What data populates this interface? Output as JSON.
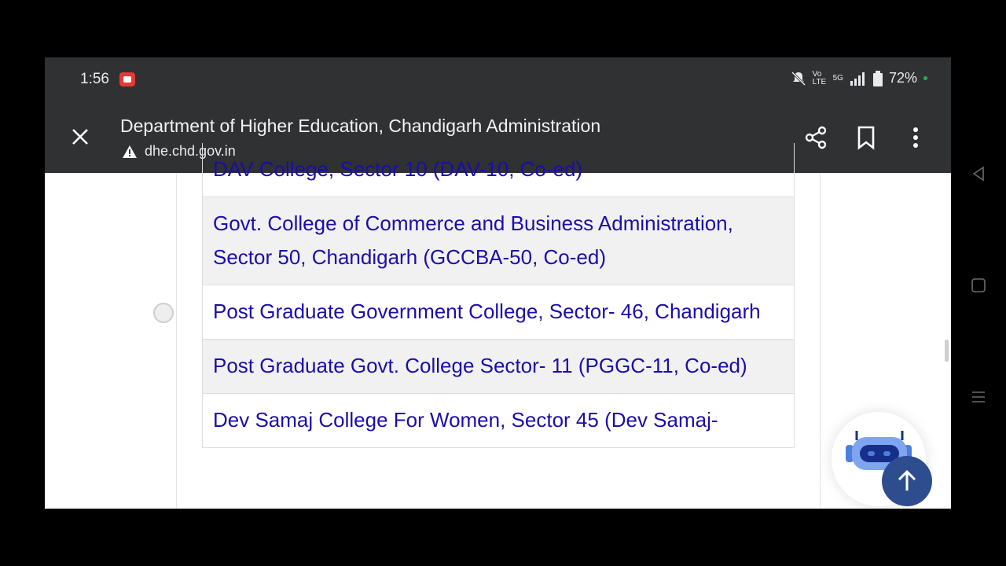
{
  "status": {
    "time": "1:56",
    "network": "5G",
    "volte": "Vo LTE",
    "battery": "72%"
  },
  "toolbar": {
    "title": "Department of Higher Education, Chandigarh Administration",
    "url": "dhe.chd.gov.in"
  },
  "colleges": [
    "DAV College, Sector 10 (DAV-10, Co-ed)",
    "Govt. College of Commerce and Business Administration, Sector 50, Chandigarh (GCCBA-50, Co-ed)",
    "Post Graduate Government College, Sector- 46, Chandigarh",
    "Post Graduate Govt. College Sector- 11 (PGGC-11, Co-ed)",
    "Dev Samaj College For Women, Sector 45 (Dev Samaj-"
  ]
}
